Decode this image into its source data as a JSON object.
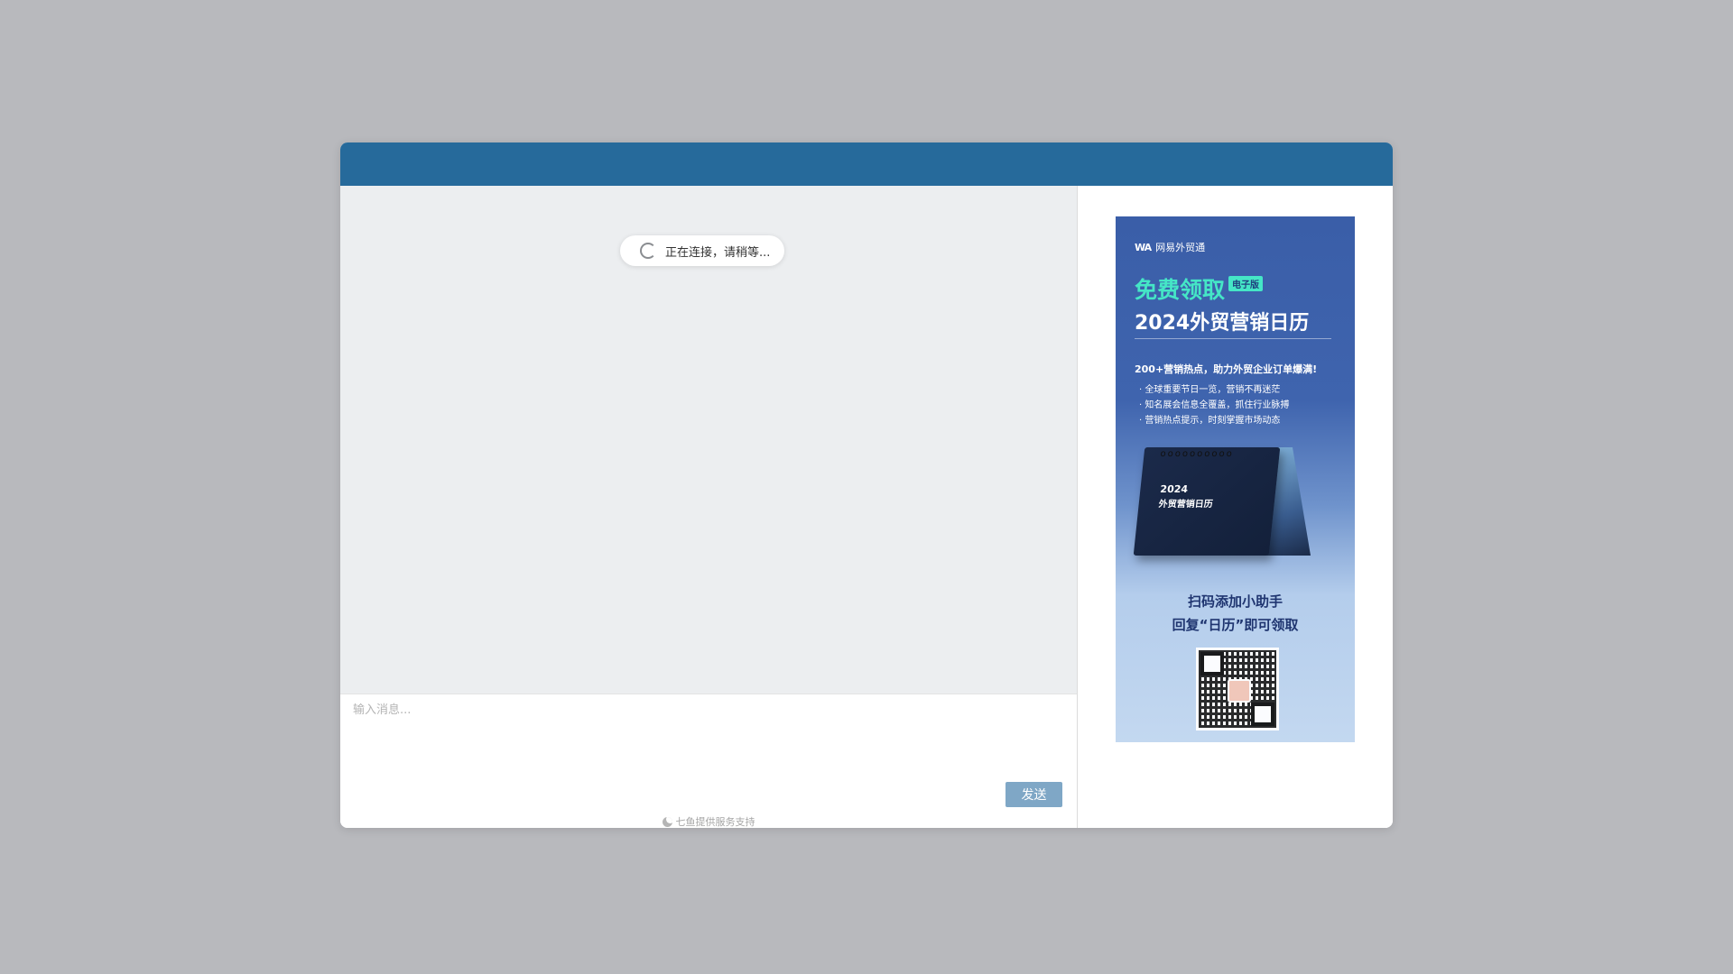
{
  "chat": {
    "connecting_status": "正在连接，请稍等...",
    "input_placeholder": "输入消息...",
    "send_label": "发送",
    "footer_credit": "七鱼提供服务支持"
  },
  "ad": {
    "brand": "网易外贸通",
    "brand_logo": "WA",
    "headline": "免费领取",
    "tag": "电子版",
    "subtitle": "2024外贸营销日历",
    "tagline": "200+营销热点，助力外贸企业订单爆满!",
    "bullets": [
      "全球重要节日一览，营销不再迷茫",
      "知名展会信息全覆盖，抓住行业脉搏",
      "营销热点提示，时刻掌握市场动态"
    ],
    "calendar_year": "2024",
    "calendar_title": "外贸营销日历",
    "cta_line1": "扫码添加小助手",
    "cta_line2": "回复“日历”即可领取"
  },
  "colors": {
    "header": "#266a9b",
    "send_button": "#7fa7c6",
    "message_area": "#eceef0",
    "ad_accent": "#45e6c6"
  }
}
